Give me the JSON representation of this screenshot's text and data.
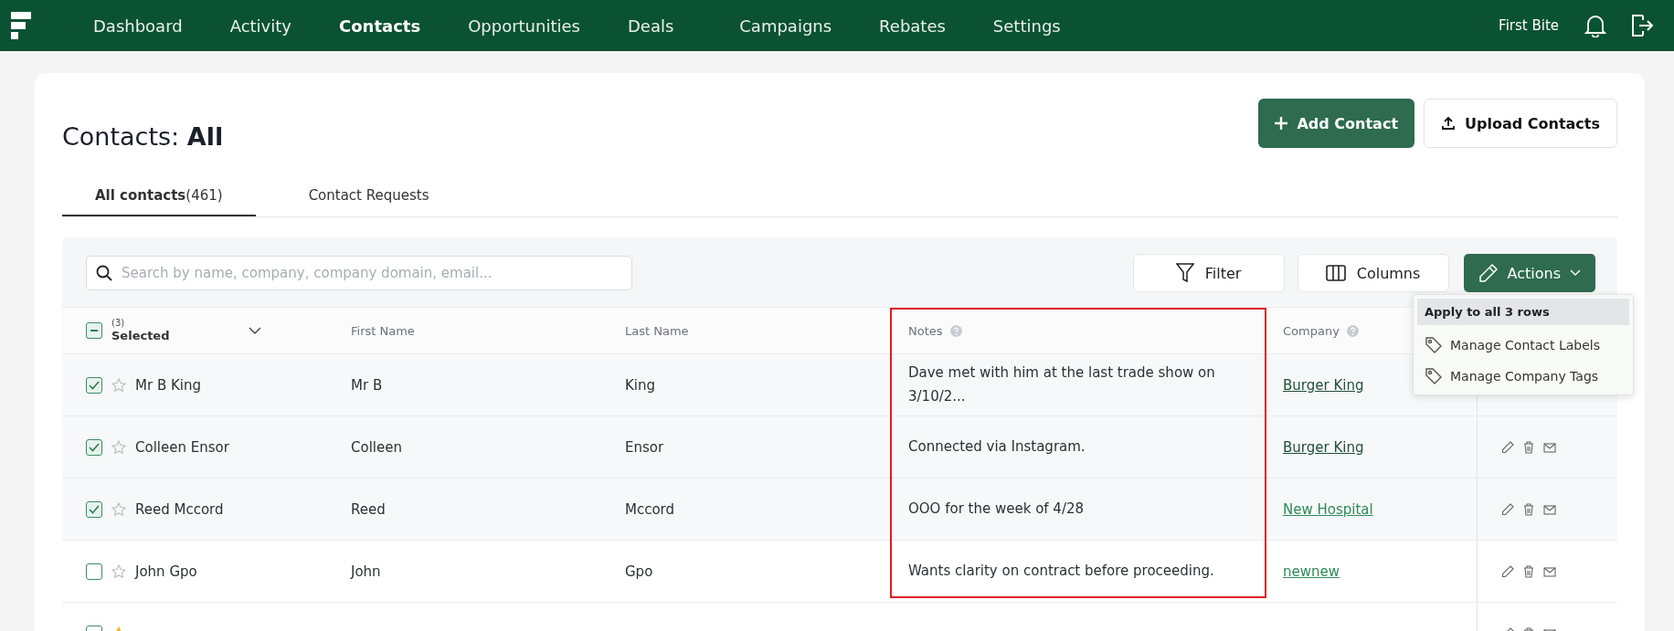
{
  "nav": {
    "items": [
      {
        "label": "Dashboard",
        "selected": false
      },
      {
        "label": "Activity",
        "selected": false
      },
      {
        "label": "Contacts",
        "selected": true
      },
      {
        "label": "Opportunities",
        "selected": false
      },
      {
        "label": "Deals",
        "selected": false
      },
      {
        "label": "Campaigns",
        "selected": false
      },
      {
        "label": "Rebates",
        "selected": false
      },
      {
        "label": "Settings",
        "selected": false
      }
    ],
    "account": "First Bite"
  },
  "page": {
    "title_prefix": "Contacts:",
    "title_bold": "All",
    "buttons": [
      {
        "kind": "primary",
        "label": "Add Contact"
      },
      {
        "kind": "secondary",
        "label": "Upload Contacts"
      }
    ]
  },
  "tabs": [
    {
      "label": "All contacts",
      "count": "(461)",
      "selected": true
    },
    {
      "label": "Contact Requests",
      "selected": false
    }
  ],
  "toolbar": {
    "search": {
      "placeholder": "Search by name, company, company domain, email..."
    },
    "filter": "Filter",
    "columns": "Columns",
    "actions": "Actions"
  },
  "table": {
    "selection": {
      "count": "(3)",
      "label": "Selected",
      "indeterminate": true
    },
    "columns": [
      {
        "label": "First Name",
        "help": false,
        "highlighted": false
      },
      {
        "label": "Last Name",
        "help": false,
        "highlighted": false
      },
      {
        "label": "Notes",
        "help": true,
        "highlighted": true
      },
      {
        "label": "Company",
        "help": true,
        "highlighted": false
      }
    ],
    "rows": [
      {
        "checked": true,
        "starred": false,
        "name": "Mr B King",
        "first": "Mr B",
        "last": "King",
        "notes": "Dave met with him at the last trade show on 3/10/2...",
        "company": "Burger King",
        "visited": true,
        "actions_visible": false
      },
      {
        "checked": true,
        "starred": false,
        "name": "Colleen Ensor",
        "first": "Colleen",
        "last": "Ensor",
        "notes": "Connected via Instagram.",
        "company": "Burger King",
        "visited": true,
        "actions_visible": true
      },
      {
        "checked": true,
        "starred": false,
        "name": "Reed Mccord",
        "first": "Reed",
        "last": "Mccord",
        "notes": "OOO for the week of 4/28",
        "company": "New Hospital",
        "visited": false,
        "actions_visible": true
      },
      {
        "checked": false,
        "starred": false,
        "name": "John Gpo",
        "first": "John",
        "last": "Gpo",
        "notes": "Wants clarity on contract before proceeding.",
        "company": "newnew",
        "visited": false,
        "actions_visible": true
      },
      {
        "checked": false,
        "starred": true,
        "actions_visible": true
      }
    ]
  },
  "actions_menu": {
    "header": "Apply to all 3 rows",
    "items": [
      "Manage Contact Labels",
      "Manage Company Tags"
    ]
  }
}
